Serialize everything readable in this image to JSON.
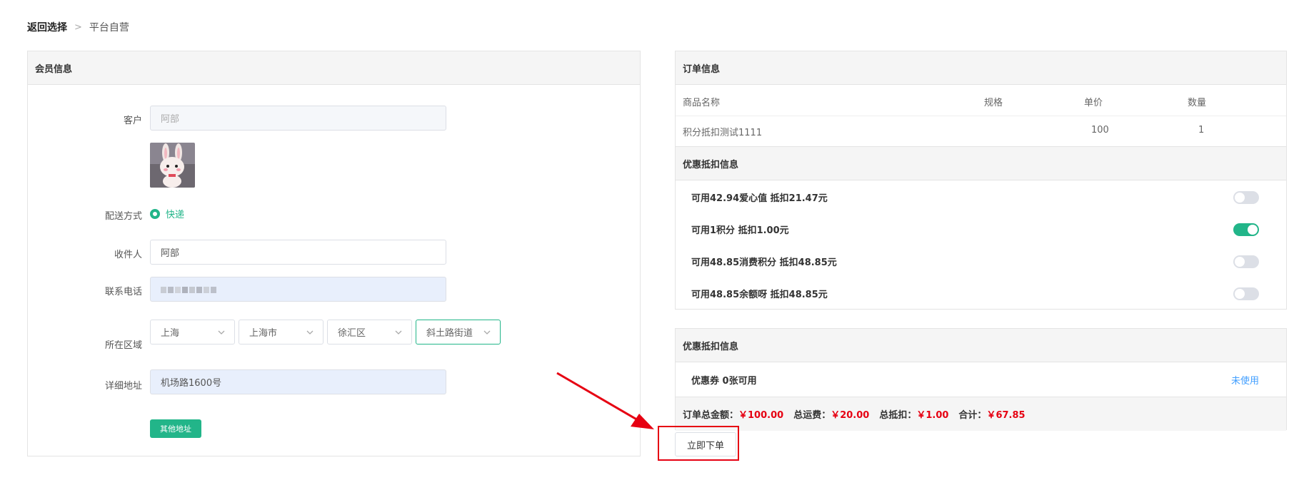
{
  "breadcrumb": {
    "back": "返回选择",
    "separator": ">",
    "current": "平台自营"
  },
  "member": {
    "title": "会员信息",
    "customer_label": "客户",
    "customer_value": "阿部",
    "delivery_label": "配送方式",
    "delivery_option": "快递",
    "recipient_label": "收件人",
    "recipient_value": "阿部",
    "phone_label": "联系电话",
    "region_label": "所在区域",
    "region": [
      "上海",
      "上海市",
      "徐汇区",
      "斜土路街道"
    ],
    "address_label": "详细地址",
    "address_value": "机场路1600号",
    "other_address_button": "其他地址"
  },
  "order": {
    "title": "订单信息",
    "columns": [
      "商品名称",
      "规格",
      "单价",
      "数量"
    ],
    "rows": [
      {
        "name": "积分抵扣测试1111",
        "spec": "",
        "price": "100",
        "qty": "1"
      }
    ],
    "discount_title": "优惠抵扣信息",
    "discounts": [
      {
        "text": "可用42.94爱心值 抵扣21.47元",
        "enabled": false
      },
      {
        "text": "可用1积分 抵扣1.00元",
        "enabled": true
      },
      {
        "text": "可用48.85消费积分 抵扣48.85元",
        "enabled": false
      },
      {
        "text": "可用48.85余额呀 抵扣48.85元",
        "enabled": false
      }
    ]
  },
  "coupon": {
    "title": "优惠抵扣信息",
    "text": "优惠券 0张可用",
    "link": "未使用",
    "summary": {
      "total_label": "订单总金额：",
      "total_value": "￥100.00",
      "shipping_label": "总运费：",
      "shipping_value": "￥20.00",
      "deduct_label": "总抵扣：",
      "deduct_value": "￥1.00",
      "sum_label": "合计：",
      "sum_value": "￥67.85"
    }
  },
  "submit_button": "立即下单",
  "colors": {
    "accent": "#22b589",
    "highlight": "#e60012",
    "link": "#409eff"
  },
  "icons": [
    "chevron-right-icon",
    "radio-selected-icon",
    "chevron-down-icon",
    "red-arrow-icon"
  ]
}
